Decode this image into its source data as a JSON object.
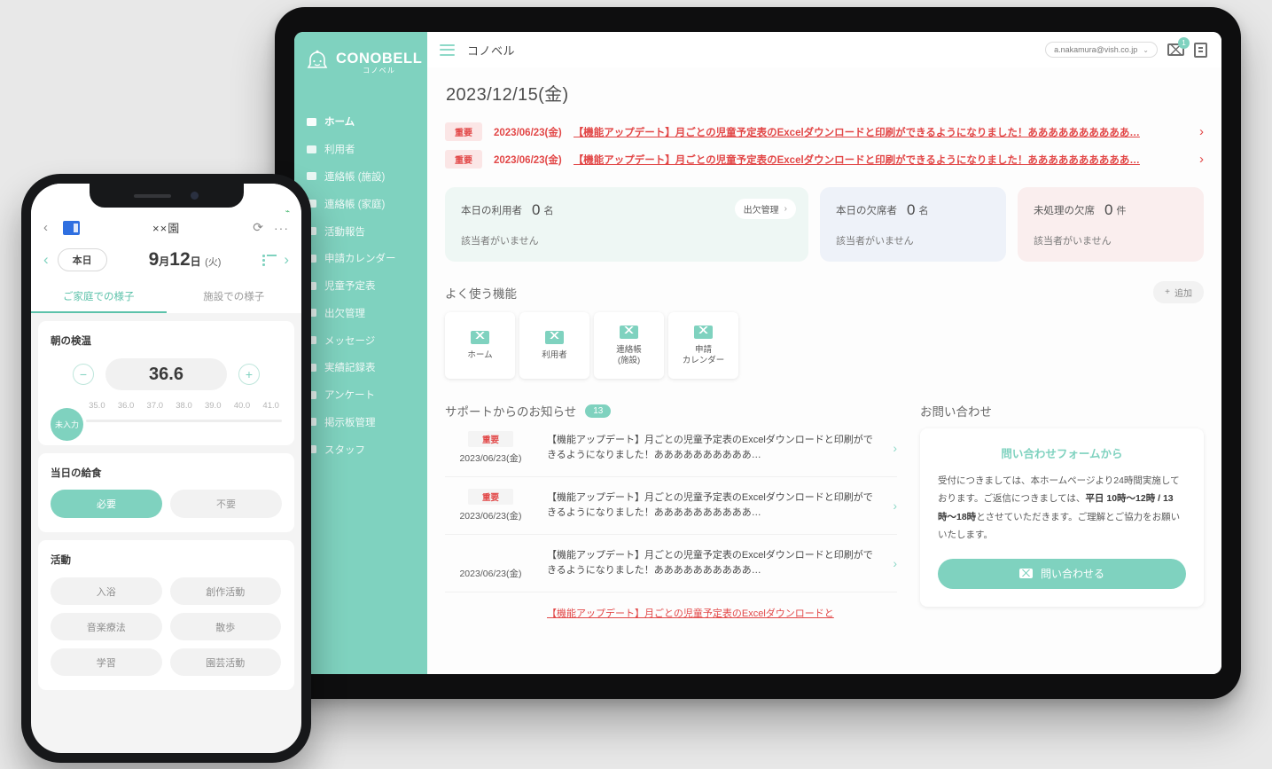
{
  "tablet": {
    "sidebar": {
      "logo_main": "CONOBELL",
      "logo_sub": "コノベル",
      "items": [
        {
          "label": "ホーム"
        },
        {
          "label": "利用者"
        },
        {
          "label": "連絡帳 (施設)"
        },
        {
          "label": "連絡帳 (家庭)"
        },
        {
          "label": "活動報告"
        },
        {
          "label": "申請カレンダー"
        },
        {
          "label": "児童予定表"
        },
        {
          "label": "出欠管理"
        },
        {
          "label": "メッセージ"
        },
        {
          "label": "実績記録表"
        },
        {
          "label": "アンケート"
        },
        {
          "label": "掲示板管理"
        },
        {
          "label": "スタッフ"
        }
      ]
    },
    "topbar": {
      "app_title": "コノベル",
      "account_email": "a.nakamura@vish.co.jp",
      "caret": "⌄",
      "mail_badge": "1"
    },
    "page_date": "2023/12/15(金)",
    "alerts": [
      {
        "badge": "重要",
        "date": "2023/06/23(金)",
        "text": "【機能アップデート】月ごとの児童予定表のExcelダウンロードと印刷ができるようになりました！ああああああああああ…",
        "chevron": "›"
      },
      {
        "badge": "重要",
        "date": "2023/06/23(金)",
        "text": "【機能アップデート】月ごとの児童予定表のExcelダウンロードと印刷ができるようになりました！ああああああああああ…",
        "chevron": "›"
      }
    ],
    "stats": [
      {
        "label": "本日の利用者",
        "value": "0",
        "unit": "名",
        "sub": "該当者がいません",
        "button": "出欠管理",
        "button_chevron": "›"
      },
      {
        "label": "本日の欠席者",
        "value": "0",
        "unit": "名",
        "sub": "該当者がいません"
      },
      {
        "label": "未処理の欠席",
        "value": "0",
        "unit": "件",
        "sub": "該当者がいません"
      }
    ],
    "favorites": {
      "title": "よく使う機能",
      "add_label": "追加",
      "add_plus": "+",
      "tiles": [
        {
          "label": "ホーム"
        },
        {
          "label": "利用者"
        },
        {
          "label": "連絡帳\n(施設)"
        },
        {
          "label": "申請\nカレンダー"
        }
      ]
    },
    "notices": {
      "title": "サポートからのお知らせ",
      "count": "13",
      "rows": [
        {
          "badge": "重要",
          "date": "2023/06/23(金)",
          "text": "【機能アップデート】月ごとの児童予定表のExcelダウンロードと印刷ができるようになりました！ああああああああああ…",
          "chevron": "›"
        },
        {
          "badge": "重要",
          "date": "2023/06/23(金)",
          "text": "【機能アップデート】月ごとの児童予定表のExcelダウンロードと印刷ができるようになりました！ああああああああああ…",
          "chevron": "›"
        },
        {
          "badge": "",
          "date": "2023/06/23(金)",
          "text": "【機能アップデート】月ごとの児童予定表のExcelダウンロードと印刷ができるようになりました！ああああああああああ…",
          "chevron": "›"
        },
        {
          "badge": "",
          "date": "",
          "text": "【機能アップデート】月ごとの児童予定表のExcelダウンロードと",
          "chevron": ""
        }
      ]
    },
    "contact": {
      "title": "お問い合わせ",
      "card_head": "問い合わせフォームから",
      "body_1": "受付につきましては、本ホームページより24時間実施しております。ご返信につきましては、",
      "body_bold": "平日 10時〜12時 / 13時〜18時",
      "body_2": "とさせていただきます。ご理解とご協力をお願いいたします。",
      "button": "問い合わせる"
    }
  },
  "phone": {
    "header": {
      "title": "××園",
      "back": "‹",
      "reload": "⟳",
      "dots": "···",
      "battery": "⌁"
    },
    "date_bar": {
      "prev": "‹",
      "next": "›",
      "today": "本日",
      "month": "9",
      "month_unit": "月",
      "day": "12",
      "day_unit": "日",
      "weekday": "(火)"
    },
    "tabs": [
      {
        "label": "ご家庭での様子",
        "active": true
      },
      {
        "label": "施設での様子",
        "active": false
      }
    ],
    "temperature": {
      "title": "朝の検温",
      "minus": "−",
      "plus": "+",
      "value": "36.6",
      "unset": "未入力",
      "scale": [
        "35.0",
        "36.0",
        "37.0",
        "38.0",
        "39.0",
        "40.0",
        "41.0"
      ]
    },
    "meal": {
      "title": "当日の給食",
      "options": [
        {
          "label": "必要",
          "selected": true
        },
        {
          "label": "不要",
          "selected": false
        }
      ]
    },
    "activity": {
      "title": "活動",
      "chips": [
        "入浴",
        "創作活動",
        "音楽療法",
        "散歩",
        "学習",
        "園芸活動"
      ]
    }
  }
}
